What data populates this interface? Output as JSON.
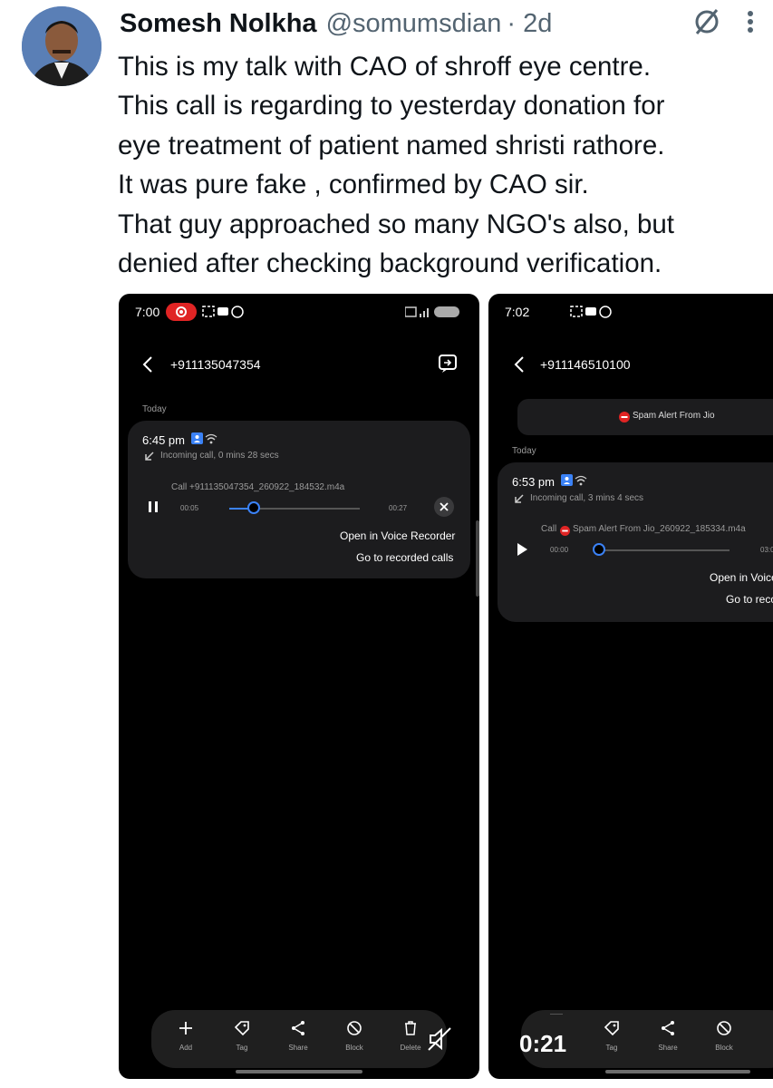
{
  "tweet": {
    "author_name": "Somesh Nolkha",
    "author_handle": "@somumsdian",
    "time": "· 2d",
    "lines": [
      "This is my talk with  CAO of shroff eye centre.",
      "This call is regarding to yesterday donation for",
      "eye treatment of patient named shristi rathore.",
      "It was pure fake , confirmed by CAO sir.",
      "That guy approached so many NGO's also, but",
      "denied after checking background verification."
    ]
  },
  "video_timer": "0:21",
  "phone1": {
    "status_time": "7:00",
    "number": "+911135047354",
    "section": "Today",
    "call_time": "6:45 pm",
    "call_meta": "Incoming call, 0 mins 28 secs",
    "recording": "Call +911135047354_260922_184532.m4a",
    "elapsed": "00:05",
    "duration": "00:27",
    "playback_progress": 0.19,
    "open_recorder": "Open in Voice Recorder",
    "go_recorded": "Go to recorded calls",
    "toolbar": [
      "Add",
      "Tag",
      "Share",
      "Block",
      "Delete"
    ]
  },
  "phone2": {
    "status_time": "7:02",
    "number": "+911146510100",
    "spam_banner": "Spam Alert From Jio",
    "section": "Today",
    "call_time": "6:53 pm",
    "call_meta": "Incoming call, 3 mins 4 secs",
    "recording_prefix": "Call",
    "recording_name": "Spam Alert From Jio_260922_185334.m4a",
    "elapsed": "00:00",
    "duration": "03:0",
    "playback_progress": 0.0,
    "open_recorder": "Open in Voice",
    "go_recorded": "Go to reco",
    "toolbar": [
      "Tag",
      "Share",
      "Block"
    ]
  },
  "colors": {
    "accent_blue": "#3b82f6",
    "record_red": "#e02424",
    "spam_red": "#e02424"
  }
}
